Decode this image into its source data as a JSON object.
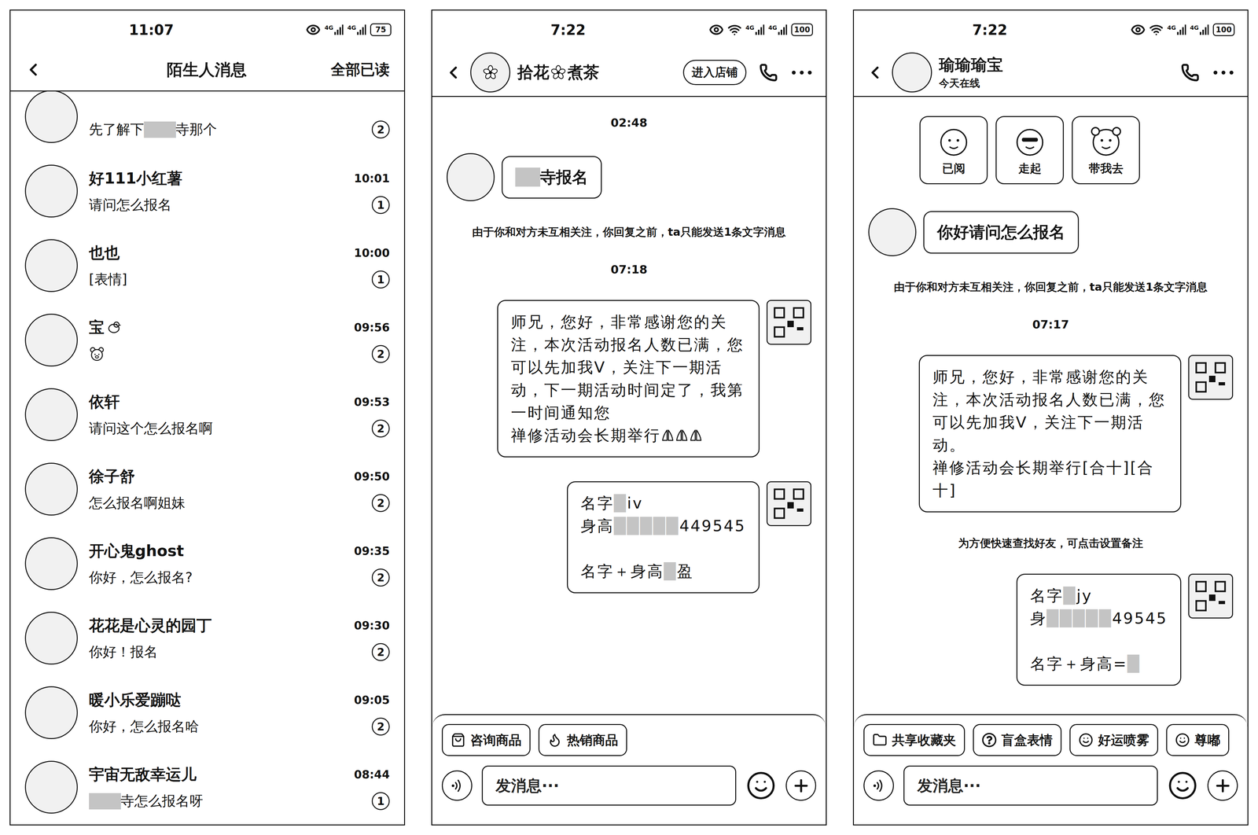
{
  "stranger_list": {
    "status_bar": {
      "time": "11:07",
      "network": [
        "4G",
        "4G"
      ],
      "wifi": false,
      "battery": "75"
    },
    "header": {
      "title": "陌生人消息",
      "action": "全部已读"
    },
    "items": [
      {
        "kind": "text",
        "preview": "先了解下███寺那个",
        "unread": "2"
      },
      {
        "kind": "text",
        "name": "好111小红薯",
        "preview": "请问怎么报名",
        "time": "10:01",
        "unread": "1"
      },
      {
        "kind": "text",
        "name": "也也",
        "preview": "[表情]",
        "time": "10:00",
        "unread": "1"
      },
      {
        "kind": "emoji",
        "name": "宝",
        "time": "09:56",
        "unread": "2"
      },
      {
        "kind": "text",
        "name": "依轩",
        "preview": "请问这个怎么报名啊",
        "time": "09:53",
        "unread": "2"
      },
      {
        "kind": "text",
        "name": "徐子舒",
        "preview": "怎么报名啊姐妹",
        "time": "09:50",
        "unread": "2"
      },
      {
        "kind": "text",
        "name": "开心鬼ghost",
        "preview": "你好，怎么报名?",
        "time": "09:35",
        "unread": "2"
      },
      {
        "kind": "text",
        "name": "花花是心灵的园丁",
        "preview": "你好！报名",
        "time": "09:30",
        "unread": "2"
      },
      {
        "kind": "text",
        "name": "暖小乐爱蹦哒",
        "preview": "你好，怎么报名哈",
        "time": "09:05",
        "unread": "2"
      },
      {
        "kind": "text",
        "name": "宇宙无敌幸运儿",
        "preview": "███寺怎么报名呀",
        "time": "08:44",
        "unread": "1"
      }
    ]
  },
  "shop_chat": {
    "status_bar": {
      "time": "7:22",
      "network": [
        "4G",
        "4G"
      ],
      "wifi": true,
      "battery": "100"
    },
    "header": {
      "title_parts": [
        "拾花",
        "煮茶"
      ],
      "shop_button": "进入店铺"
    },
    "messages": [
      {
        "kind": "time",
        "text": "02:48"
      },
      {
        "kind": "incoming",
        "text": "██寺报名"
      },
      {
        "kind": "system",
        "text": "由于你和对方未互相关注，你回复之前，ta只能发送1条文字消息"
      },
      {
        "kind": "time",
        "text": "07:18"
      },
      {
        "kind": "outgoing",
        "blocks": [
          [
            "师兄，您好，非常感谢您的关注，本次活动报名人数已满，您可以先加我V，关注下一期活动，下一期活动时间定了，我第一时间通知您",
            "禅修活动会长期举行"
          ]
        ],
        "prayer_icons": 3
      },
      {
        "kind": "outgoing",
        "blocks": [
          [
            "名字█iv",
            "身高█████449545"
          ],
          [
            "名字＋身高█盈"
          ]
        ],
        "prayer_icons": 0
      }
    ],
    "toolbar": {
      "chips": [
        "咨询商品",
        "热销商品"
      ],
      "input_placeholder": "发消息···"
    }
  },
  "user_chat": {
    "status_bar": {
      "time": "7:22",
      "network": [
        "4G",
        "4G"
      ],
      "wifi": true,
      "battery": "100"
    },
    "header": {
      "title_parts": [
        "瑜瑜瑜宝"
      ],
      "subtitle": "今天在线"
    },
    "messages": [
      {
        "kind": "stickers",
        "items": [
          "已阅",
          "走起",
          "带我去"
        ]
      },
      {
        "kind": "incoming",
        "text": "你好请问怎么报名"
      },
      {
        "kind": "system",
        "text": "由于你和对方未互相关注，你回复之前，ta只能发送1条文字消息"
      },
      {
        "kind": "time",
        "text": "07:17"
      },
      {
        "kind": "outgoing",
        "blocks": [
          [
            "师兄，您好，非常感谢您的关注，本次活动报名人数已满，您可以先加我V，关注下一期活动。",
            "禅修活动会长期举行[合十][合十]"
          ]
        ],
        "prayer_icons": 0
      },
      {
        "kind": "system",
        "text": "为方便快速查找好友，可点击设置备注"
      },
      {
        "kind": "outgoing",
        "blocks": [
          [
            "名字█jy",
            "身█████49545"
          ],
          [
            "名字＋身高=█"
          ]
        ],
        "prayer_icons": 0
      }
    ],
    "toolbar": {
      "chips": [
        "共享收藏夹",
        "盲盒表情",
        "好运喷雾",
        "尊嘟"
      ],
      "input_placeholder": "发消息···"
    }
  }
}
